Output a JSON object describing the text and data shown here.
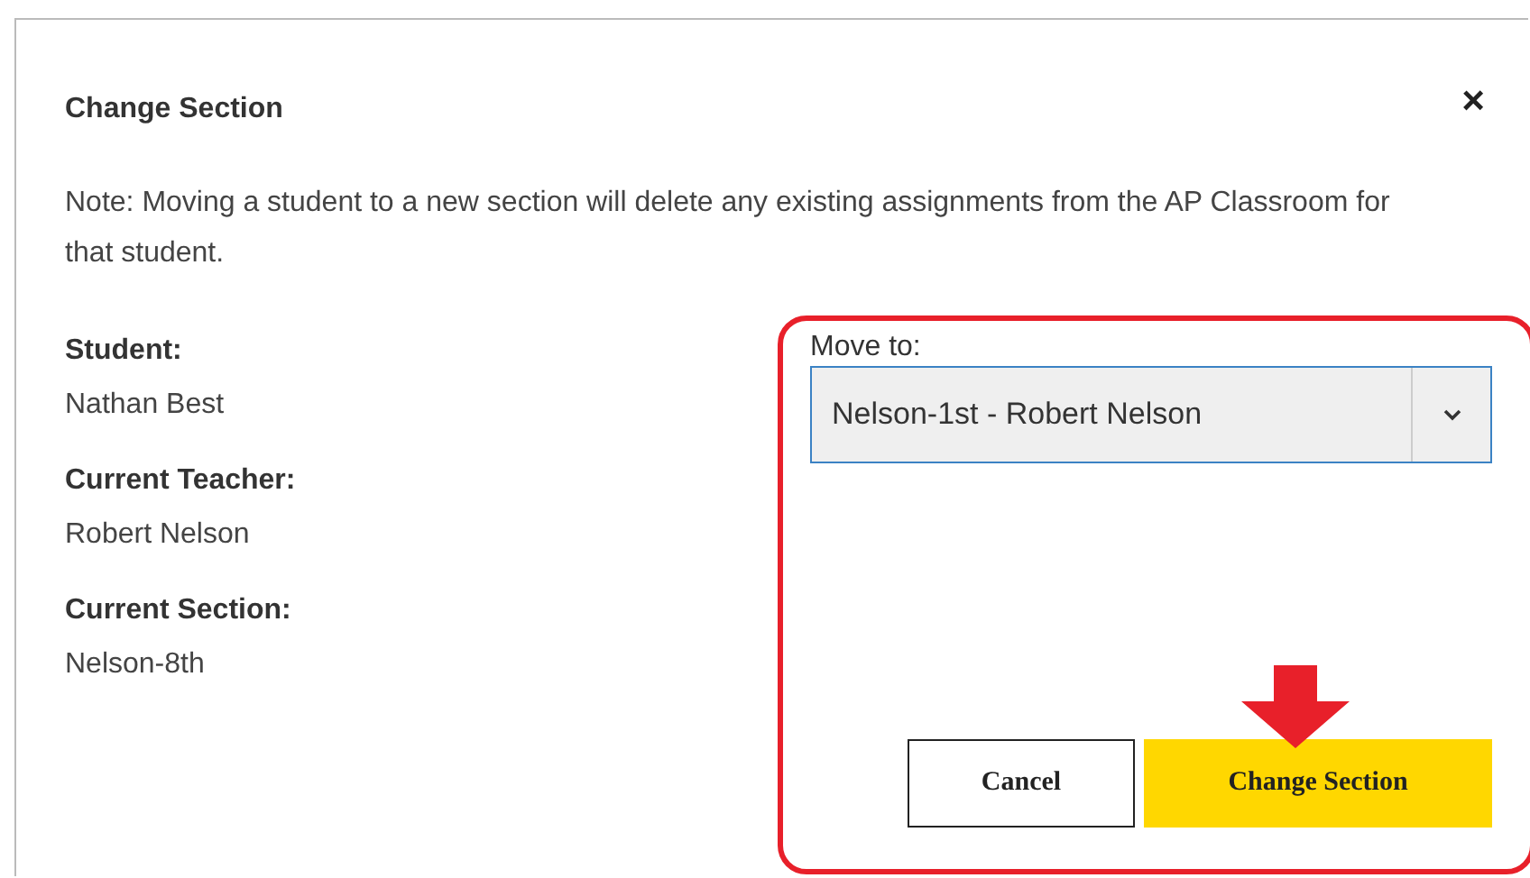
{
  "dialog": {
    "title": "Change Section",
    "close": "×",
    "note": "Note: Moving a student to a new section will delete any existing assignments from the AP Classroom for that student.",
    "fields": [
      {
        "label": "Student:",
        "value": "Nathan Best"
      },
      {
        "label": "Current Teacher:",
        "value": "Robert Nelson"
      },
      {
        "label": "Current Section:",
        "value": "Nelson-8th"
      }
    ],
    "move_to": {
      "label": "Move to:",
      "value": "Nelson-1st - Robert Nelson"
    },
    "buttons": [
      {
        "label": "Cancel",
        "kind": "secondary"
      },
      {
        "label": "Change Section",
        "kind": "primary"
      }
    ]
  }
}
